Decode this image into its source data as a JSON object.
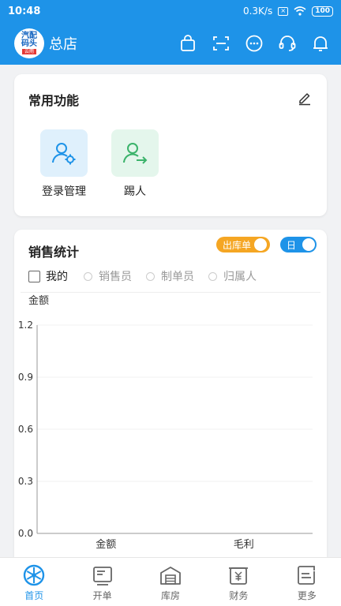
{
  "status": {
    "time": "10:48",
    "speed": "0.3K/s",
    "battery": "100"
  },
  "header": {
    "store_name": "总店",
    "logo_text_1": "汽配",
    "logo_text_2": "码头",
    "logo_sub": "云雨"
  },
  "common": {
    "title": "常用功能",
    "items": [
      {
        "label": "登录管理",
        "icon": "user-settings-icon",
        "bg": "#dff0fc",
        "color": "#1e93e8"
      },
      {
        "label": "踢人",
        "icon": "user-kick-icon",
        "bg": "#e4f6ec",
        "color": "#3bb36b"
      }
    ]
  },
  "sales": {
    "title": "销售统计",
    "toggle_type": "出库单",
    "toggle_period": "日",
    "filter_me": "我的",
    "filter_options": [
      "销售员",
      "制单员",
      "归属人"
    ]
  },
  "chart_data": {
    "type": "bar",
    "ylabel": "金额",
    "categories": [
      "金额",
      "毛利"
    ],
    "values": [
      0,
      0
    ],
    "yticks": [
      "1.2",
      "0.9",
      "0.6",
      "0.3",
      "0.0"
    ],
    "ylim": [
      0,
      1.2
    ],
    "grid": true
  },
  "tabs": [
    {
      "label": "首页",
      "icon": "home-wheel-icon",
      "active": true
    },
    {
      "label": "开单",
      "icon": "order-icon",
      "active": false
    },
    {
      "label": "库房",
      "icon": "warehouse-icon",
      "active": false
    },
    {
      "label": "财务",
      "icon": "finance-icon",
      "active": false
    },
    {
      "label": "更多",
      "icon": "more-icon",
      "active": false
    }
  ],
  "colors": {
    "primary": "#1e93e8",
    "orange": "#f5a623",
    "green": "#3bb36b"
  }
}
